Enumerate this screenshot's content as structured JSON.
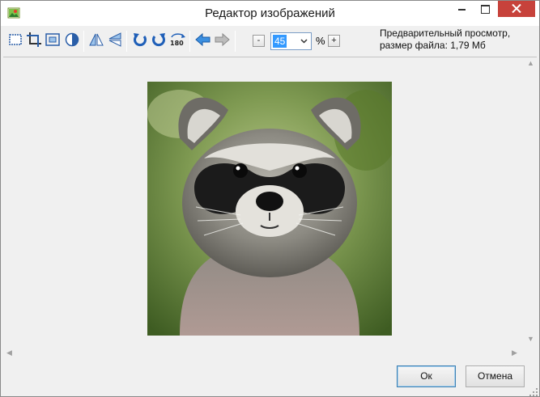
{
  "window": {
    "title": "Редактор изображений",
    "icon": "image-editor-app-icon",
    "close_color": "#c7423b"
  },
  "toolbar": {
    "tools": [
      {
        "name": "select-rectangle-icon",
        "group": 1
      },
      {
        "name": "crop-icon",
        "group": 1
      },
      {
        "name": "resize-canvas-icon",
        "group": 1
      },
      {
        "name": "color-adjust-icon",
        "group": 1
      },
      {
        "name": "flip-horizontal-icon",
        "group": 2
      },
      {
        "name": "flip-vertical-icon",
        "group": 2
      },
      {
        "name": "rotate-left-icon",
        "group": 3
      },
      {
        "name": "rotate-right-icon",
        "group": 3
      },
      {
        "name": "rotate-180-icon",
        "group": 3,
        "label": "180"
      },
      {
        "name": "undo-arrow-icon",
        "group": 4
      },
      {
        "name": "redo-arrow-icon",
        "group": 4
      }
    ],
    "zoom": {
      "minus_label": "-",
      "value": "45",
      "percent_label": "%",
      "plus_label": "+"
    },
    "preview_line1": "Предварительный просмотр,",
    "preview_line2": "размер файла: 1,79 Мб"
  },
  "canvas": {
    "image_subject": "raccoon-photo",
    "background": "#f0f0f0"
  },
  "buttons": {
    "ok_label": "Ок",
    "cancel_label": "Отмена"
  }
}
